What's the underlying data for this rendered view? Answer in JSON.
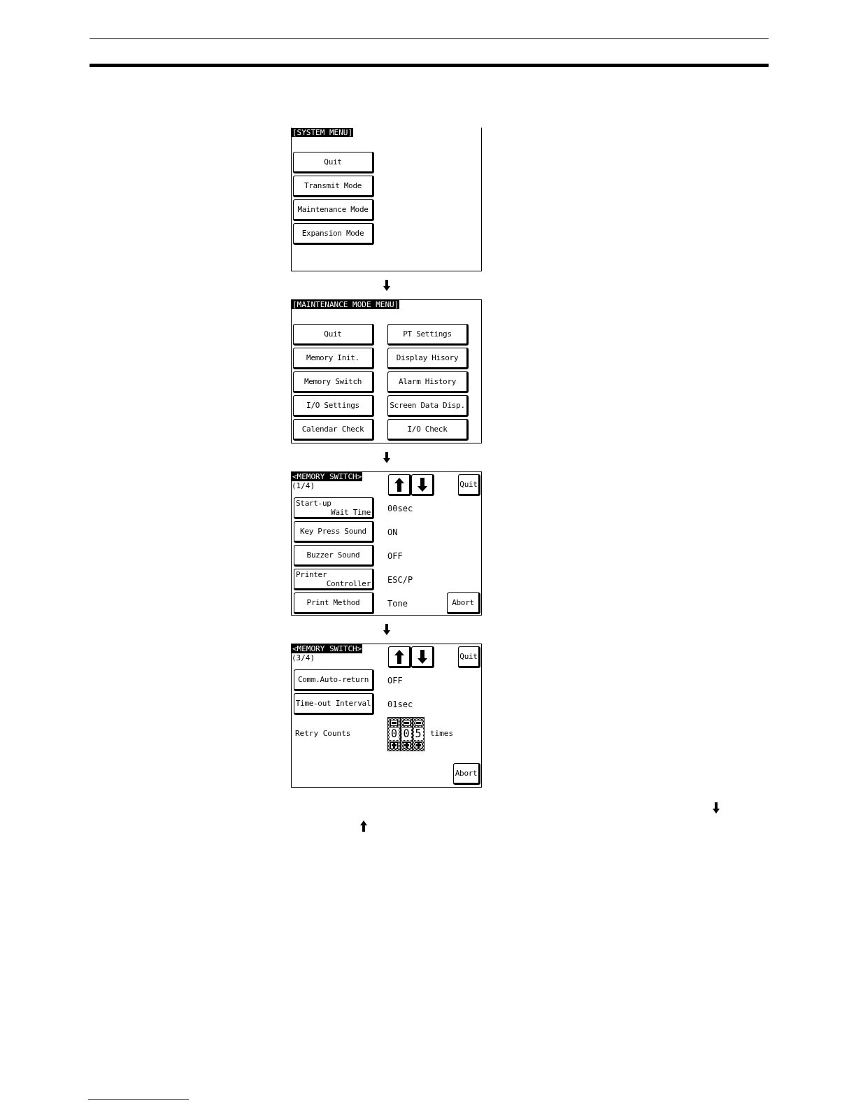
{
  "screens": [
    {
      "kind": "menu",
      "title": "[SYSTEM MENU]",
      "columns": [
        [
          "Quit",
          "Transmit Mode",
          "Maintenance Mode",
          "Expansion Mode"
        ]
      ]
    },
    {
      "kind": "menu",
      "title": "[MAINTENANCE MODE MENU]",
      "columns": [
        [
          "Quit",
          "Memory Init.",
          "Memory Switch",
          "I/O Settings",
          "Calendar Check"
        ],
        [
          "PT Settings",
          "Display Hisory",
          "Alarm History",
          "Screen Data Disp.",
          "I/O Check"
        ]
      ]
    },
    {
      "kind": "settings",
      "title": "<MEMORY SWITCH>",
      "page": "(1/4)",
      "quit": "Quit",
      "abort": "Abort",
      "rows": [
        {
          "kind": "button",
          "lines": [
            "Start-up",
            "Wait Time"
          ],
          "value": "00sec"
        },
        {
          "kind": "button",
          "lines": [
            "Key Press Sound"
          ],
          "value": "ON"
        },
        {
          "kind": "button",
          "lines": [
            "Buzzer Sound"
          ],
          "value": "OFF"
        },
        {
          "kind": "button",
          "lines": [
            "Printer",
            "Controller"
          ],
          "value": "ESC/P"
        },
        {
          "kind": "button",
          "lines": [
            "Print Method"
          ],
          "value": "Tone"
        }
      ]
    },
    {
      "kind": "settings",
      "title": "<MEMORY SWITCH>",
      "page": "(3/4)",
      "quit": "Quit",
      "abort": "Abort",
      "rows": [
        {
          "kind": "button",
          "lines": [
            "Comm.Auto-return"
          ],
          "value": "OFF"
        },
        {
          "kind": "button",
          "lines": [
            "Time-out Interval"
          ],
          "value": "01sec"
        },
        {
          "kind": "counter",
          "label": "Retry Counts",
          "digits": [
            "0",
            "0",
            "5"
          ],
          "unit": "times"
        }
      ]
    }
  ]
}
